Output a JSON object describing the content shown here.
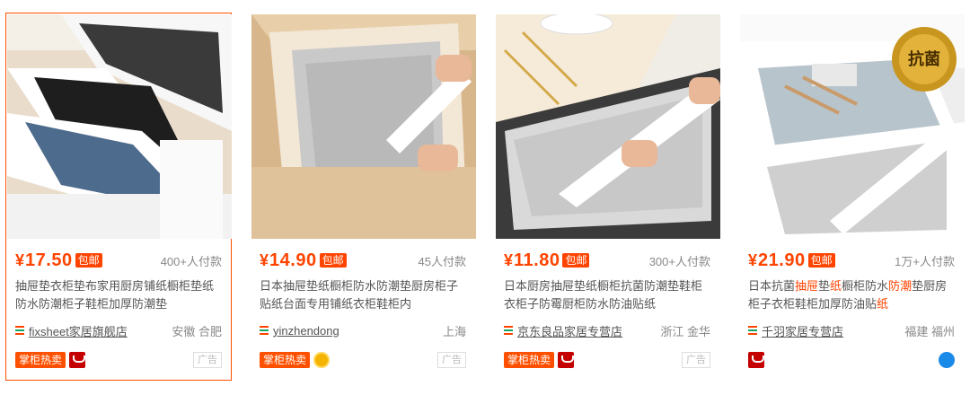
{
  "colors": {
    "accent": "#ff4400",
    "active_border": "#ff5000"
  },
  "products": [
    {
      "currency": "¥",
      "price": "17.50",
      "free_shipping": "包邮",
      "sold": "400+人付款",
      "title_parts": [
        "抽屉垫衣柜垫布家用厨房铺纸橱柜垫纸防水防潮柜子鞋柜加厚防潮垫"
      ],
      "shop": "fixsheet家居旗舰店",
      "location": "安徽 合肥",
      "hot_label": "掌柜热卖",
      "badge_icon": "tmall-icon",
      "ad_label": "广告"
    },
    {
      "currency": "¥",
      "price": "14.90",
      "free_shipping": "包邮",
      "sold": "45人付款",
      "title_parts": [
        "日本抽屉垫纸橱柜防水防潮垫厨房柜子贴纸台面专用铺纸衣柜鞋柜内"
      ],
      "shop": "yinzhendong",
      "location": "上海",
      "hot_label": "掌柜热卖",
      "badge_icon": "gold-medal-icon",
      "ad_label": "广告"
    },
    {
      "currency": "¥",
      "price": "11.80",
      "free_shipping": "包邮",
      "sold": "300+人付款",
      "title_parts": [
        "日本厨房抽屉垫纸橱柜抗菌防潮垫鞋柜衣柜子防霉厨柜防水防油贴纸"
      ],
      "shop": "京东良品家居专营店",
      "location": "浙江 金华",
      "hot_label": "掌柜热卖",
      "badge_icon": "tmall-icon",
      "ad_label": "广告"
    },
    {
      "currency": "¥",
      "price": "21.90",
      "free_shipping": "包邮",
      "sold": "1万+人付款",
      "title_parts": [
        "日本抗菌",
        "抽屉",
        "垫",
        "纸",
        "橱柜防水",
        "防潮",
        "垫厨房柜子衣柜鞋柜加厚防油贴",
        "纸"
      ],
      "title_highlight": [
        false,
        true,
        false,
        true,
        false,
        true,
        false,
        true
      ],
      "shop": "千羽家居专营店",
      "location": "福建 福州",
      "badge_icon": "tmall-icon",
      "badge_icon_right": "blue-drop-icon"
    }
  ]
}
